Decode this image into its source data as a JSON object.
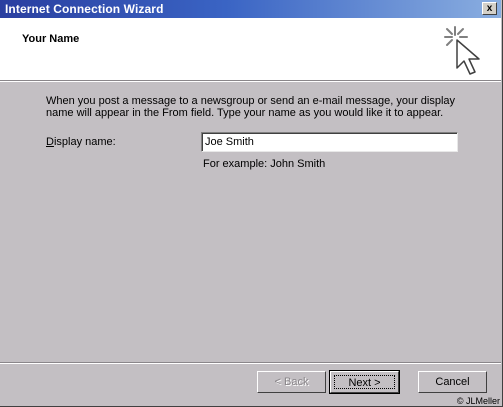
{
  "window": {
    "title": "Internet Connection Wizard",
    "close_label": "x"
  },
  "header": {
    "title": "Your Name",
    "icon": "wizard-cursor-icon"
  },
  "content": {
    "description": "When you post a message to a newsgroup or send an e-mail message, your display name will appear in the From field.  Type your name as you would like it to appear.",
    "display_name_label_underlined": "D",
    "display_name_label_rest": "isplay name:",
    "display_name_value": "Joe Smith",
    "example_text": "For example: John Smith"
  },
  "buttons": {
    "back_label": "< Back",
    "next_label": "Next >",
    "cancel_label": "Cancel"
  },
  "footer": {
    "copyright": "© JLMeller"
  }
}
